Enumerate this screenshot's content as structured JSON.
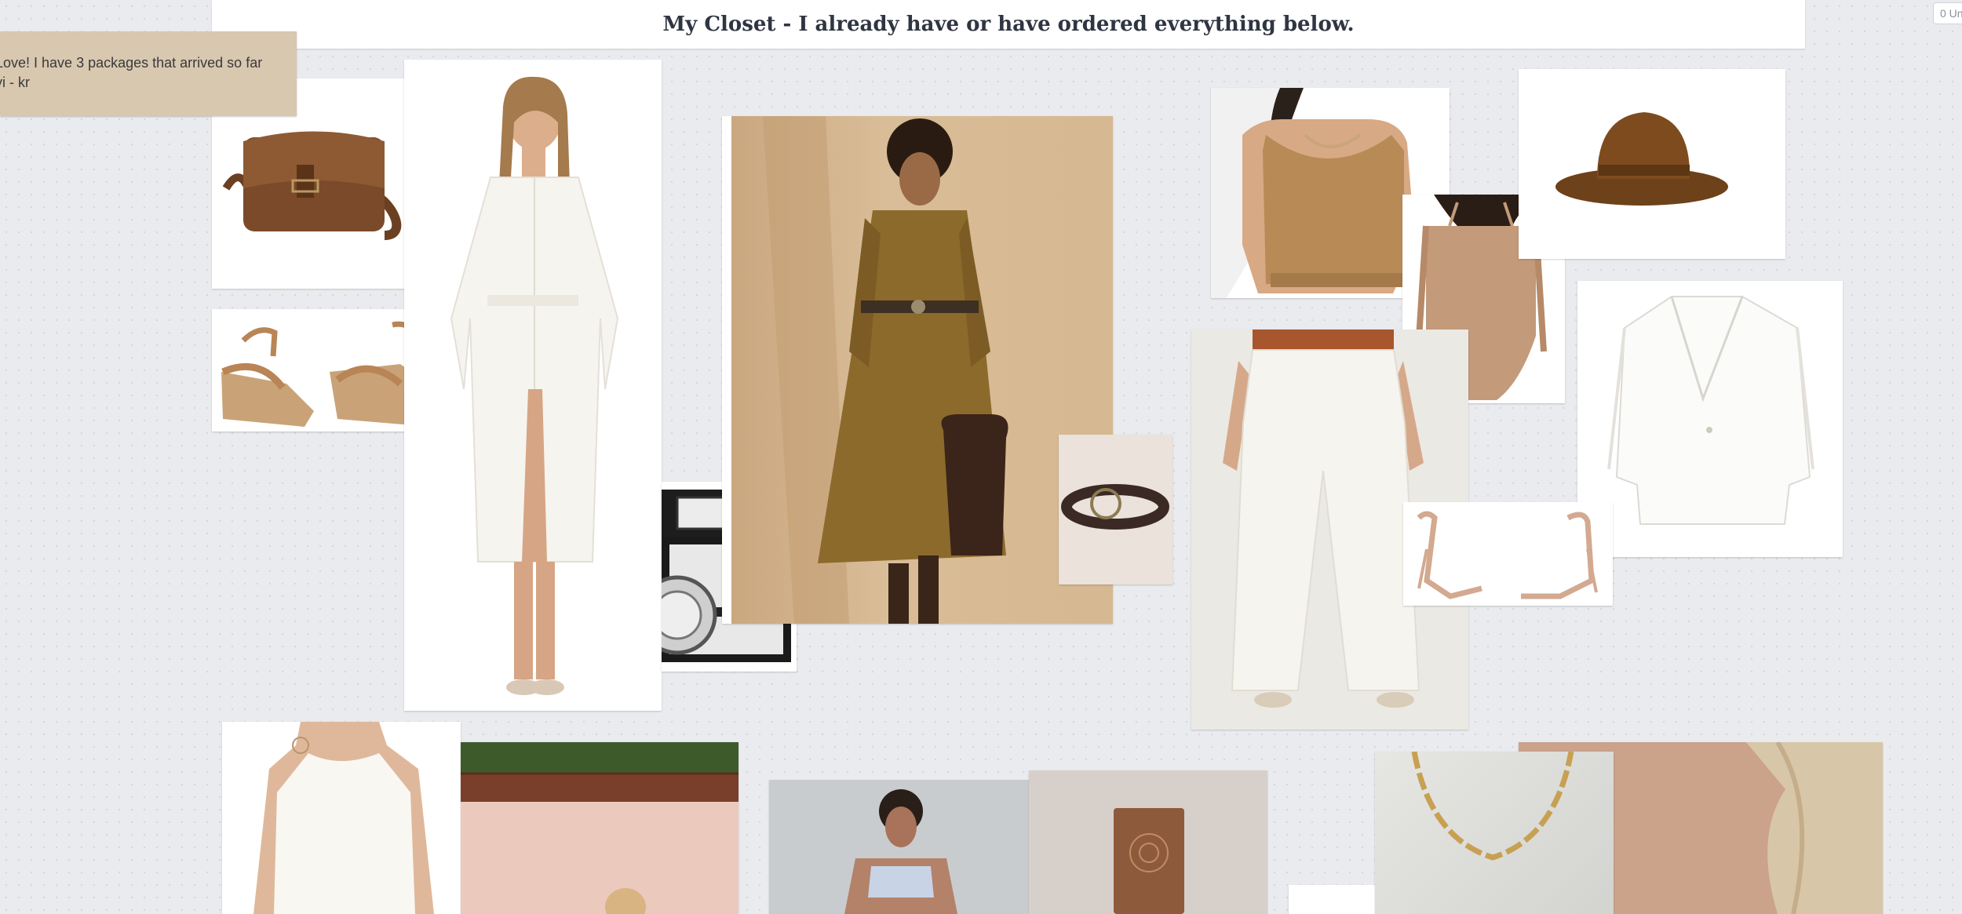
{
  "board": {
    "title": "My Closet - I already have or have ordered everything  below.",
    "counter": "0 Un"
  },
  "note": {
    "lines": [
      "Love! I have 3 packages that arrived so far",
      "yi - kr"
    ]
  },
  "colors": {
    "board_bg": "#e9ebee",
    "note_bg": "#d8c8b0",
    "camel": "#a77c47",
    "cream": "#f6f3ec"
  }
}
